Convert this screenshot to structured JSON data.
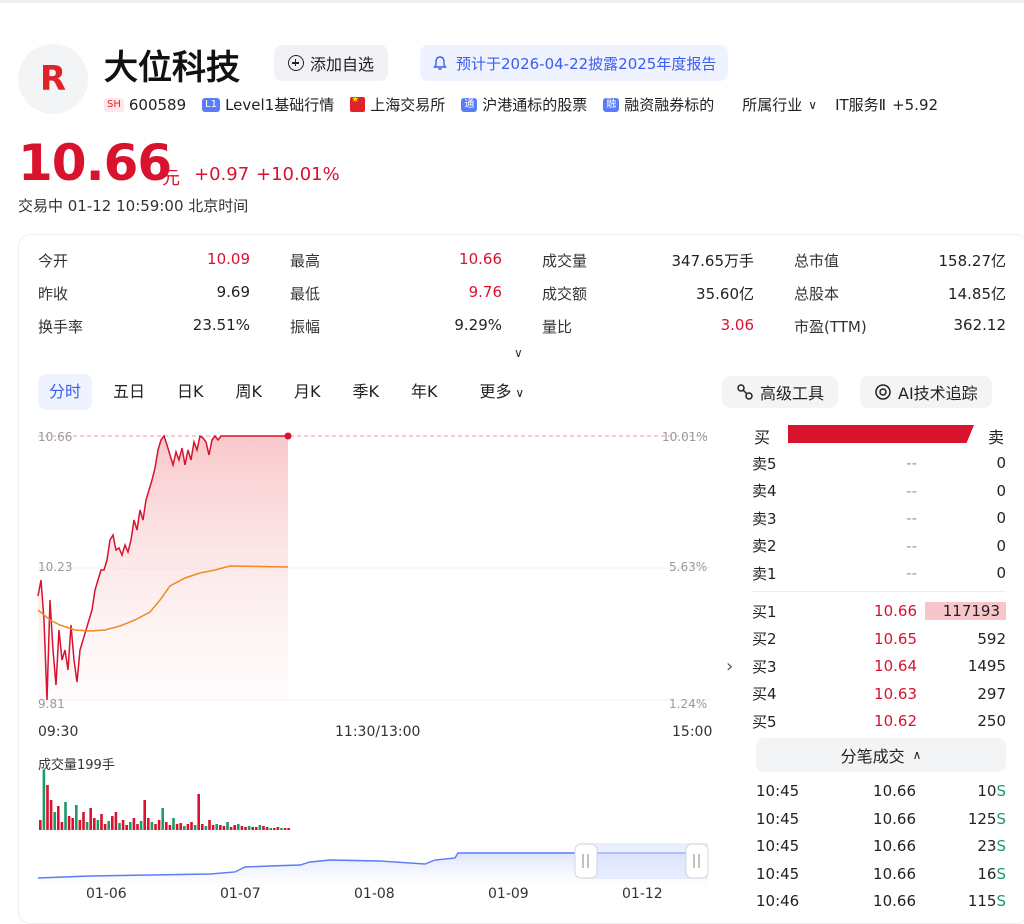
{
  "header": {
    "logo_letter": "R",
    "name": "大位科技",
    "add_watch": "添加自选",
    "notice": "预计于2026-04-22披露2025年度报告",
    "market_tag": "SH",
    "code": "600589",
    "level_tag": "L1",
    "level": "Level1基础行情",
    "exchange": "上海交易所",
    "connect_tag": "通",
    "connect": "沪港通标的股票",
    "margin_tag": "融",
    "margin": "融资融券标的",
    "industry_label": "所属行业",
    "industry": "IT服务Ⅱ",
    "industry_chg": "+5.92"
  },
  "quote": {
    "price": "10.66",
    "unit": "元",
    "change": "+0.97",
    "change_pct": "+10.01%",
    "status": "交易中  01-12 10:59:00 北京时间"
  },
  "stats": [
    {
      "label": "今开",
      "value": "10.09",
      "red": true
    },
    {
      "label": "最高",
      "value": "10.66",
      "red": true
    },
    {
      "label": "成交量",
      "value": "347.65万手",
      "red": false
    },
    {
      "label": "总市值",
      "value": "158.27亿",
      "red": false
    },
    {
      "label": "昨收",
      "value": "9.69",
      "red": false
    },
    {
      "label": "最低",
      "value": "9.76",
      "red": true
    },
    {
      "label": "成交额",
      "value": "35.60亿",
      "red": false
    },
    {
      "label": "总股本",
      "value": "14.85亿",
      "red": false
    },
    {
      "label": "换手率",
      "value": "23.51%",
      "red": false
    },
    {
      "label": "振幅",
      "value": "9.29%",
      "red": false
    },
    {
      "label": "量比",
      "value": "3.06",
      "red": true
    },
    {
      "label": "市盈(TTM)",
      "value": "362.12",
      "red": false
    }
  ],
  "tabs": [
    "分时",
    "五日",
    "日K",
    "周K",
    "月K",
    "季K",
    "年K",
    "更多"
  ],
  "tools": {
    "advanced": "高级工具",
    "ai": "AI技术追踪"
  },
  "chart_axes": {
    "y_top": "10.66",
    "y_mid": "10.23",
    "y_bot": "9.81",
    "pct_top": "10.01%",
    "pct_mid": "5.63%",
    "pct_bot": "1.24%",
    "t_start": "09:30",
    "t_mid": "11:30/13:00",
    "t_end": "15:00",
    "volume_label": "成交量199手"
  },
  "minimap_dates": [
    "01-06",
    "01-07",
    "01-08",
    "01-09",
    "01-12"
  ],
  "orderbook": {
    "buy_label": "买",
    "sell_label": "卖",
    "asks": [
      {
        "name": "卖5",
        "price": "--",
        "vol": "0"
      },
      {
        "name": "卖4",
        "price": "--",
        "vol": "0"
      },
      {
        "name": "卖3",
        "price": "--",
        "vol": "0"
      },
      {
        "name": "卖2",
        "price": "--",
        "vol": "0"
      },
      {
        "name": "卖1",
        "price": "--",
        "vol": "0"
      }
    ],
    "bids": [
      {
        "name": "买1",
        "price": "10.66",
        "vol": "117193"
      },
      {
        "name": "买2",
        "price": "10.65",
        "vol": "592"
      },
      {
        "name": "买3",
        "price": "10.64",
        "vol": "1495"
      },
      {
        "name": "买4",
        "price": "10.63",
        "vol": "297"
      },
      {
        "name": "买5",
        "price": "10.62",
        "vol": "250"
      }
    ]
  },
  "ticks_title": "分笔成交",
  "ticks": [
    {
      "time": "10:45",
      "price": "10.66",
      "vol": "10",
      "side": "S"
    },
    {
      "time": "10:45",
      "price": "10.66",
      "vol": "125",
      "side": "S"
    },
    {
      "time": "10:45",
      "price": "10.66",
      "vol": "23",
      "side": "S"
    },
    {
      "time": "10:45",
      "price": "10.66",
      "vol": "16",
      "side": "S"
    },
    {
      "time": "10:46",
      "price": "10.66",
      "vol": "115",
      "side": "S"
    }
  ],
  "colors": {
    "up": "#d9122e",
    "down": "#1a9b6a",
    "avg": "#f08a24",
    "accent": "#3d5cf0"
  }
}
